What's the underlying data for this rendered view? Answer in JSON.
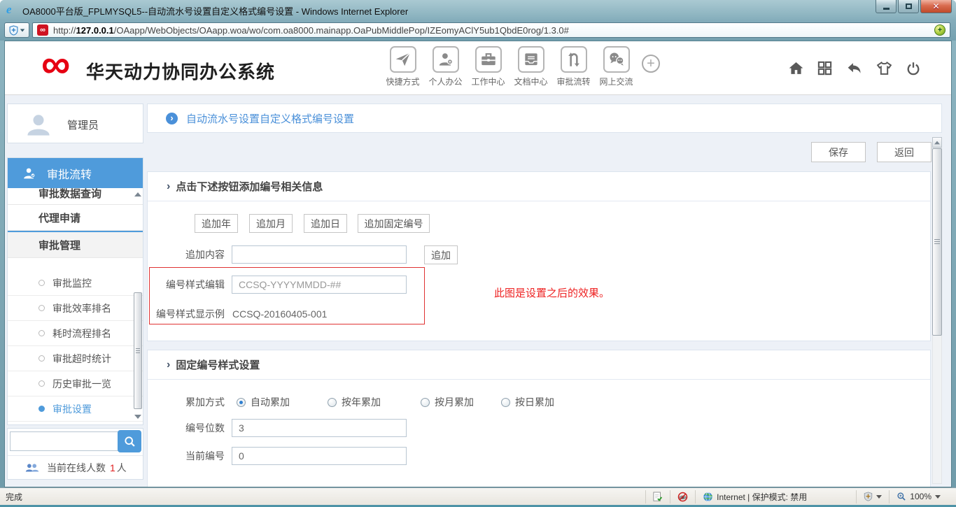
{
  "window": {
    "title": "OA8000平台版_FPLMYSQL5--自动流水号设置自定义格式编号设置 - Windows Internet Explorer",
    "url_scheme": "http://",
    "url_domain": "127.0.0.1",
    "url_path": "/OAapp/WebObjects/OAapp.woa/wo/com.oa8000.mainapp.OaPubMiddlePop/IZEomyAClY5ub1QbdE0rog/1.3.0#",
    "status": "完成",
    "security_zone": "Internet | 保护模式: 禁用",
    "zoom_level": "100%"
  },
  "header": {
    "brand": "华天动力协同办公系统",
    "nav": [
      {
        "label": "快捷方式",
        "icon": "paper-plane-icon"
      },
      {
        "label": "个人办公",
        "icon": "person-icon"
      },
      {
        "label": "工作中心",
        "icon": "briefcase-icon"
      },
      {
        "label": "文档中心",
        "icon": "document-tray-icon"
      },
      {
        "label": "审批流转",
        "icon": "uturn-arrows-icon"
      },
      {
        "label": "网上交流",
        "icon": "chat-bubbles-icon"
      }
    ]
  },
  "sidebar": {
    "user_name": "管理员",
    "group_title": "审批流转",
    "item_data_query": "审批数据查询",
    "item_agent": "代理申请",
    "item_manage": "审批管理",
    "sub_items": [
      {
        "label": "审批监控",
        "selected": false
      },
      {
        "label": "审批效率排名",
        "selected": false
      },
      {
        "label": "耗时流程排名",
        "selected": false
      },
      {
        "label": "审批超时统计",
        "selected": false
      },
      {
        "label": "历史审批一览",
        "selected": false
      },
      {
        "label": "审批设置",
        "selected": true
      }
    ],
    "online_label": "当前在线人数",
    "online_count": "1",
    "online_unit": "人"
  },
  "main": {
    "page_title": "自动流水号设置自定义格式编号设置",
    "save_label": "保存",
    "back_label": "返回",
    "section_add": {
      "title": "点击下述按钮添加编号相关信息",
      "btn_year": "追加年",
      "btn_month": "追加月",
      "btn_day": "追加日",
      "btn_fixed": "追加固定编号",
      "content_label": "追加内容",
      "append_label": "追加",
      "style_edit_label": "编号样式编辑",
      "style_edit_value": "CCSQ-YYYYMMDD-##",
      "style_sample_label": "编号样式显示例",
      "style_sample_value": "CCSQ-20160405-001",
      "annotation": "此图是设置之后的效果。"
    },
    "section_fixed": {
      "title": "固定编号样式设置",
      "mode_label": "累加方式",
      "mode_options": [
        {
          "label": "自动累加",
          "checked": true
        },
        {
          "label": "按年累加",
          "checked": false
        },
        {
          "label": "按月累加",
          "checked": false
        },
        {
          "label": "按日累加",
          "checked": false
        }
      ],
      "digits_label": "编号位数",
      "digits_value": "3",
      "current_label": "当前编号",
      "current_value": "0"
    }
  },
  "colors": {
    "accent_blue": "#4f9bdb",
    "brand_red": "#e60012",
    "annotation_red": "#ee2222",
    "titlebar_teal": "#86afbc"
  }
}
